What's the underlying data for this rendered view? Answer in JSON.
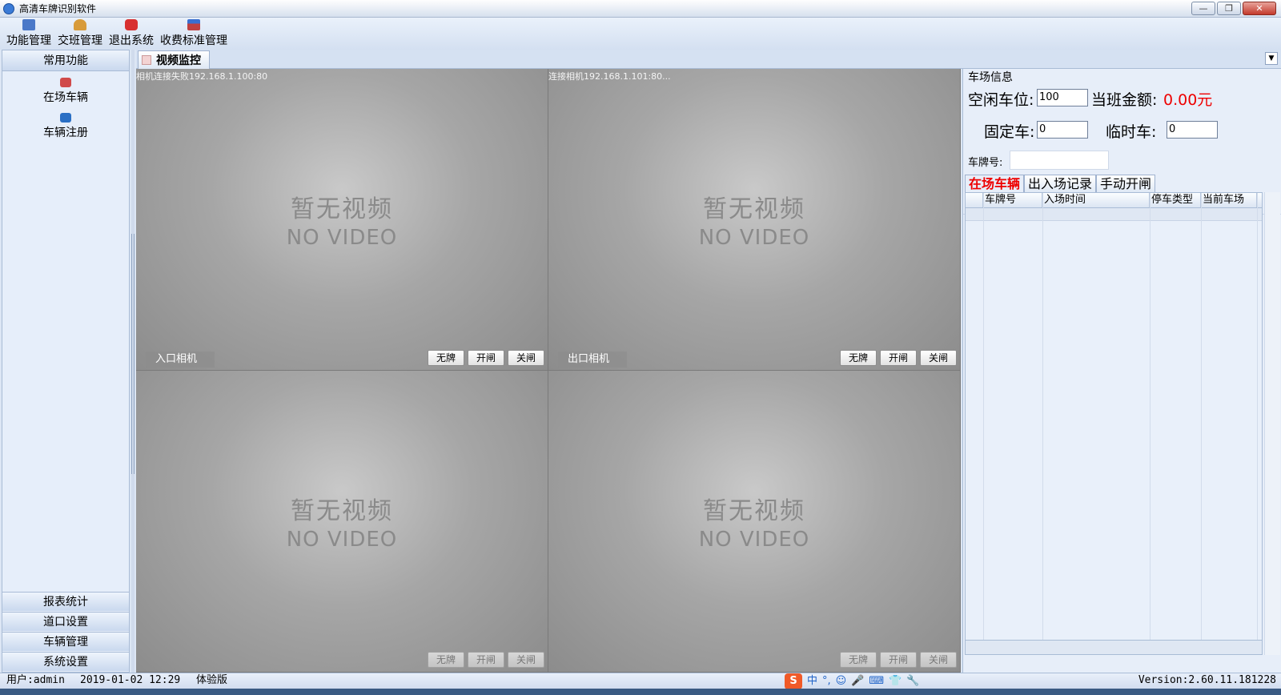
{
  "window": {
    "title": "高清车牌识别软件",
    "minimize": "—",
    "restore": "❐",
    "close": "✕"
  },
  "menu": [
    {
      "label": "功能管理",
      "icon": "function-icon",
      "color": "#4a78c8"
    },
    {
      "label": "交班管理",
      "icon": "user-icon",
      "color": "#d89b3a"
    },
    {
      "label": "退出系统",
      "icon": "power-icon",
      "color": "#d83030"
    },
    {
      "label": "收费标准管理",
      "icon": "fee-icon",
      "color": "#c04040"
    }
  ],
  "sidebar": {
    "header": "常用功能",
    "functions": [
      {
        "label": "在场车辆",
        "icon": "car-icon",
        "color": "#d04a4a"
      },
      {
        "label": "车辆注册",
        "icon": "car-register-icon",
        "color": "#2a6fc4"
      }
    ],
    "bottom": [
      "报表统计",
      "道口设置",
      "车辆管理",
      "系统设置"
    ]
  },
  "center_tab": {
    "label": "视频监控",
    "dropdown": "▼"
  },
  "videos": [
    {
      "status": "相机连接失败192.168.1.100:80",
      "name": "入口相机",
      "no_video_cn": "暂无视频",
      "no_video_en": "NO VIDEO",
      "buttons": [
        "无牌",
        "开闸",
        "关闸"
      ]
    },
    {
      "status": "连接相机192.168.1.101:80...",
      "name": "出口相机",
      "no_video_cn": "暂无视频",
      "no_video_en": "NO VIDEO",
      "buttons": [
        "无牌",
        "开闸",
        "关闸"
      ]
    },
    {
      "status": "",
      "name": "",
      "no_video_cn": "暂无视频",
      "no_video_en": "NO VIDEO",
      "buttons": [
        "无牌",
        "开闸",
        "关闸"
      ]
    },
    {
      "status": "",
      "name": "",
      "no_video_cn": "暂无视频",
      "no_video_en": "NO VIDEO",
      "buttons": [
        "无牌",
        "开闸",
        "关闸"
      ]
    }
  ],
  "lot_info": {
    "title": "车场信息",
    "free_label": "空闲车位:",
    "free_value": "100",
    "shift_amount_label": "当班金额:",
    "shift_amount_value": "0.00元",
    "fixed_label": "固定车:",
    "fixed_value": "0",
    "temp_label": "临时车:",
    "temp_value": "0",
    "plate_label": "车牌号:",
    "plate_value": ""
  },
  "right_tabs": [
    "在场车辆",
    "出入场记录",
    "手动开闸"
  ],
  "grid": {
    "columns": [
      "",
      "车牌号",
      "入场时间",
      "停车类型",
      "当前车场"
    ]
  },
  "status": {
    "user": "用户:admin",
    "time": "2019-01-02 12:29",
    "edition": "体验版",
    "version": "Version:2.60.11.181228",
    "ime": {
      "logo": "S",
      "mode": "中",
      "items": [
        "°,",
        "☺",
        "🎤",
        "⌨",
        "👕",
        "🔧"
      ]
    }
  }
}
